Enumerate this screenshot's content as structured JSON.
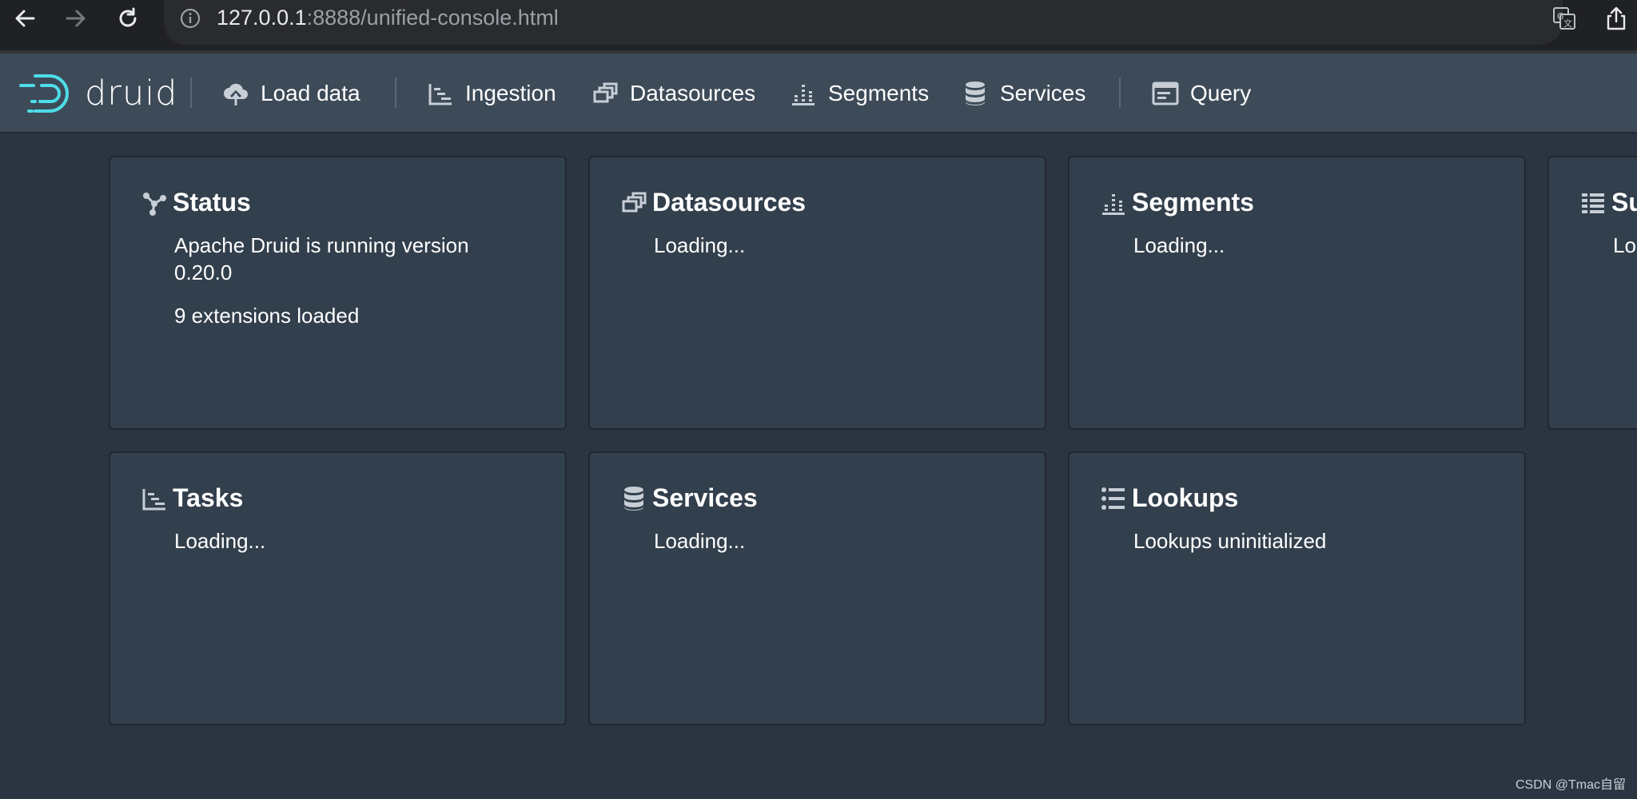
{
  "browser": {
    "url_host": "127.0.0.1",
    "url_rest": ":8888/unified-console.html",
    "icons": [
      "back-arrow-icon",
      "forward-arrow-icon",
      "reload-icon",
      "info-icon",
      "translate-icon",
      "share-icon"
    ]
  },
  "header": {
    "logo_text": "druid",
    "nav": [
      {
        "label": "Load data",
        "icon": "cloud-upload-icon"
      },
      {
        "label": "Ingestion",
        "icon": "gantt-chart-icon"
      },
      {
        "label": "Datasources",
        "icon": "multi-select-icon"
      },
      {
        "label": "Segments",
        "icon": "stacked-chart-icon"
      },
      {
        "label": "Services",
        "icon": "database-icon"
      },
      {
        "label": "Query",
        "icon": "application-icon"
      }
    ]
  },
  "cards": [
    {
      "title": "Status",
      "icon": "graph-icon",
      "lines": [
        "Apache Druid is running version 0.20.0",
        "9 extensions loaded"
      ]
    },
    {
      "title": "Datasources",
      "icon": "multi-select-icon",
      "lines": [
        "Loading..."
      ]
    },
    {
      "title": "Segments",
      "icon": "stacked-chart-icon",
      "lines": [
        "Loading..."
      ]
    },
    {
      "title": "Su",
      "icon": "properties-icon",
      "lines": [
        "Lo"
      ]
    },
    {
      "title": "Tasks",
      "icon": "gantt-chart-icon",
      "lines": [
        "Loading..."
      ]
    },
    {
      "title": "Services",
      "icon": "database-icon",
      "lines": [
        "Loading..."
      ]
    },
    {
      "title": "Lookups",
      "icon": "list-icon",
      "lines": [
        "Lookups uninitialized"
      ]
    }
  ],
  "watermark": "CSDN @Tmac自留",
  "colors": {
    "page_bg": "#2b3541",
    "header_bg": "#3d4a58",
    "card_bg": "#323f4c",
    "icon_gray": "#c7ced6",
    "logo_cyan": "#4ddde8"
  }
}
